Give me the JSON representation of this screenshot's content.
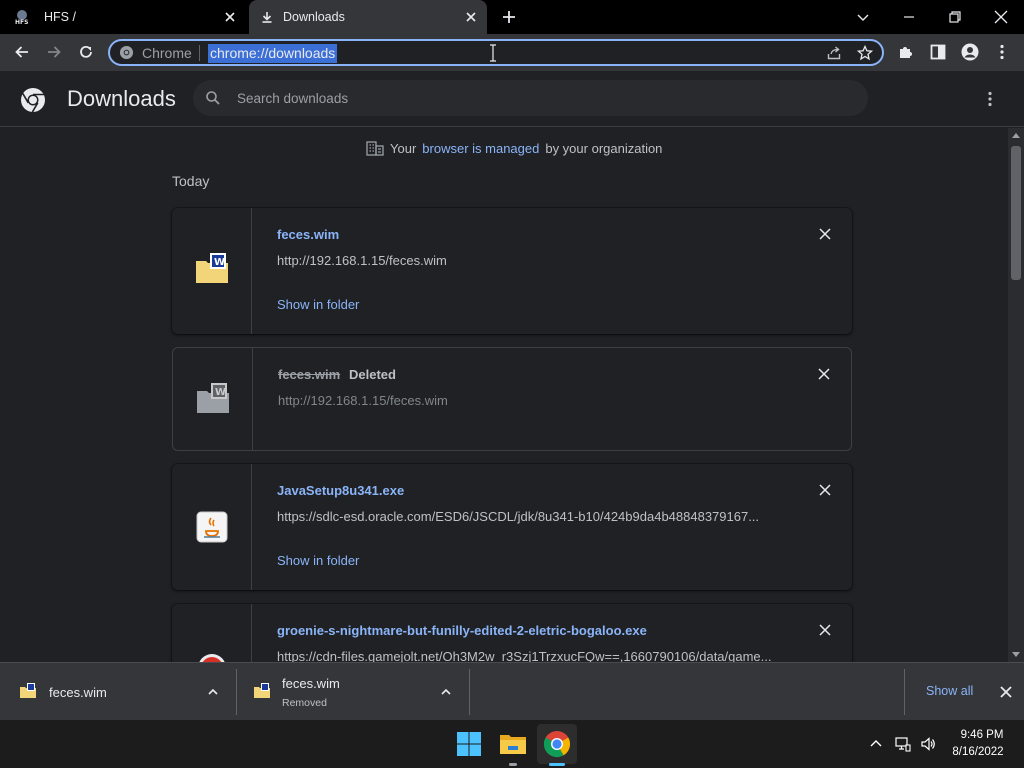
{
  "tabs": [
    {
      "title": "HFS /",
      "icon": "hfs-favicon"
    },
    {
      "title": "Downloads",
      "icon": "download-icon",
      "active": true
    }
  ],
  "omnibox": {
    "scheme_label": "Chrome",
    "url": "chrome://downloads"
  },
  "header": {
    "title": "Downloads",
    "search_placeholder": "Search downloads"
  },
  "managed": {
    "prefix": "Your",
    "link": "browser is managed",
    "suffix": "by your organization"
  },
  "date_label": "Today",
  "downloads": [
    {
      "name": "feces.wim",
      "url": "http://192.168.1.15/feces.wim",
      "action": "Show in folder"
    },
    {
      "name": "feces.wim",
      "status": "Deleted",
      "url": "http://192.168.1.15/feces.wim"
    },
    {
      "name": "JavaSetup8u341.exe",
      "url": "https://sdlc-esd.oracle.com/ESD6/JSCDL/jdk/8u341-b10/424b9da4b48848379167...",
      "action": "Show in folder"
    },
    {
      "name": "groenie-s-nightmare-but-funilly-edited-2-eletric-bogaloo.exe",
      "url": "https://cdn-files.gamejolt.net/Oh3M2w_r3Szj1TrzxucFQw==,1660790106/data/game..."
    }
  ],
  "shelf": {
    "items": [
      {
        "name": "feces.wim",
        "sub": ""
      },
      {
        "name": "feces.wim",
        "sub": "Removed"
      }
    ],
    "show_all": "Show all"
  },
  "taskbar": {
    "time": "9:46 PM",
    "date": "8/16/2022"
  },
  "colors": {
    "accent": "#8ab4f8",
    "background": "#202124",
    "toolbar": "#35363a"
  }
}
